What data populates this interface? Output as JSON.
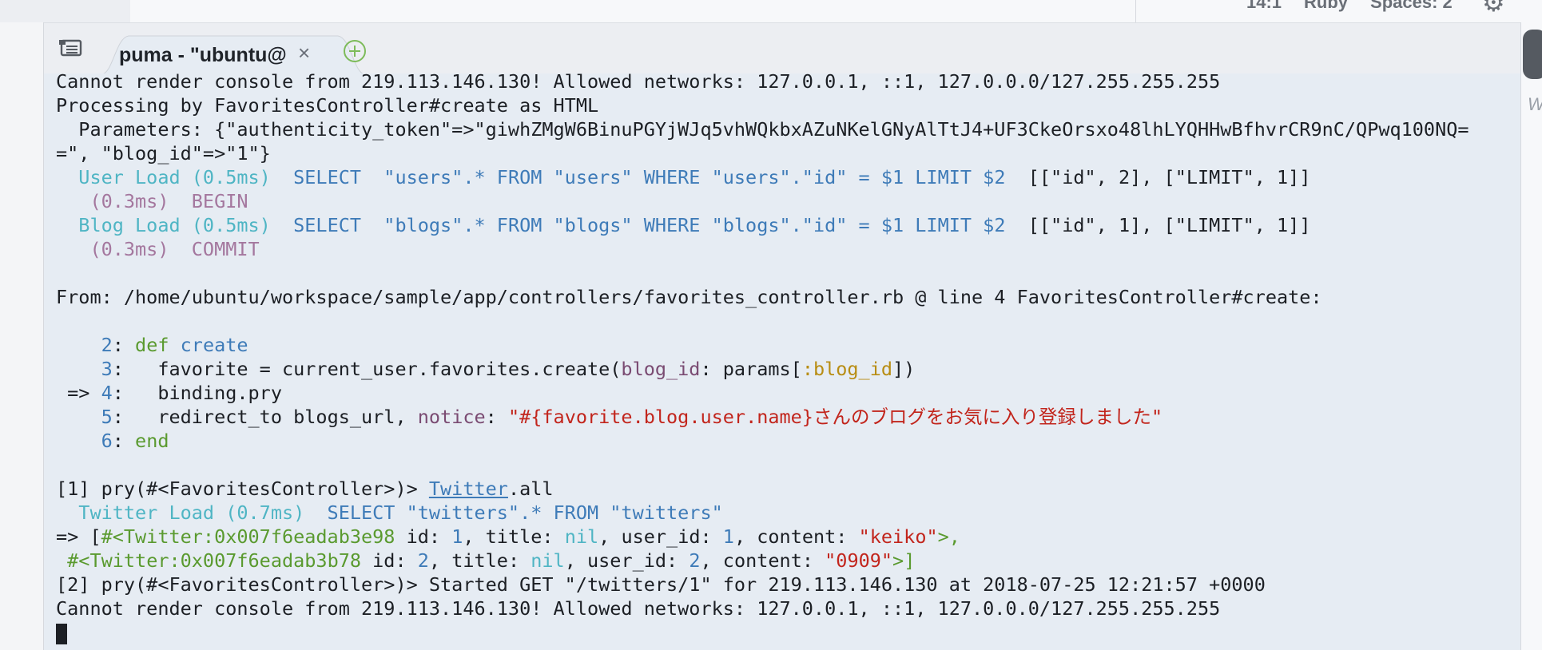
{
  "status_bar": {
    "cursor_pos": "14:1",
    "language": "Ruby",
    "indent": "Spaces: 2"
  },
  "tab": {
    "title": "puma - \"ubuntu@",
    "close_glyph": "×"
  },
  "right_edge": {
    "link_text": "W"
  },
  "icons": {
    "tablist": "tablist-icon",
    "add_tab": "plus-circle-icon",
    "settings": "gear-icon"
  },
  "colors": {
    "cyan": "#4fb5c4",
    "blue": "#3e7bb8",
    "magenta": "#a4779e",
    "green": "#5a9a2f",
    "red": "#c2251c"
  },
  "terminal": {
    "l01": "Cannot render console from 219.113.146.130! Allowed networks: 127.0.0.1, ::1, 127.0.0.0/127.255.255.255",
    "l02": "Processing by FavoritesController#create as HTML",
    "l03": "  Parameters: {\"authenticity_token\"=>\"giwhZMgW6BinuPGYjWJq5vhWQkbxAZuNKelGNyAlTtJ4+UF3CkeOrsxo48lhLYQHHwBfhvrCR9nC/QPwq100NQ=",
    "l04": "=\", \"blog_id\"=>\"1\"}",
    "l05_a": "  User Load (0.5ms)",
    "l05_b": "  SELECT  \"users\".* FROM \"users\" WHERE \"users\".\"id\" = $1 LIMIT $2",
    "l05_c": "  [[\"id\", 2], [\"LIMIT\", 1]]",
    "l06_a": "   (0.3ms)  BEGIN",
    "l07_a": "  Blog Load (0.5ms)",
    "l07_b": "  SELECT  \"blogs\".* FROM \"blogs\" WHERE \"blogs\".\"id\" = $1 LIMIT $2",
    "l07_c": "  [[\"id\", 1], [\"LIMIT\", 1]]",
    "l08_a": "   (0.3ms)  COMMIT",
    "l10": "From: /home/ubuntu/workspace/sample/app/controllers/favorites_controller.rb @ line 4 FavoritesController#create:",
    "l12_num": "    2",
    "l12_sep": ": ",
    "l12_kw": "def",
    "l12_name": " create",
    "l13_num": "    3",
    "l13_a": ":   favorite = current_user.favorites.create(",
    "l13_key": "blog_id",
    "l13_b": ": params[",
    "l13_sym": ":blog_id",
    "l13_c": "])",
    "l14_arrow": " => ",
    "l14_num": "4",
    "l14_a": ":   binding.pry",
    "l15_num": "    5",
    "l15_a": ":   redirect_to blogs_url, ",
    "l15_key": "notice",
    "l15_b": ": ",
    "l15_str": "\"#{favorite.blog.user.name}さんのブログをお気に入り登録しました\"",
    "l16_num": "    6",
    "l16_sep": ": ",
    "l16_kw": "end",
    "l18_a": "[1] pry(#<FavoritesController>)> ",
    "l18_link": "Twitter",
    "l18_b": ".all",
    "l19_a": "  Twitter Load (0.7ms)",
    "l19_b": "  SELECT \"twitters\".* FROM \"twitters\"",
    "l20_a": "=> [",
    "l20_obj": "#<Twitter:0x007f6eadab3e98",
    "l20_b": " id: ",
    "l20_n1": "1",
    "l20_c": ", title: ",
    "l20_nil": "nil",
    "l20_d": ", user_id: ",
    "l20_n2": "1",
    "l20_e": ", content: ",
    "l20_str": "\"keiko\"",
    "l20_f": ">,",
    "l21_a": " ",
    "l21_obj": "#<Twitter:0x007f6eadab3b78",
    "l21_b": " id: ",
    "l21_n1": "2",
    "l21_c": ", title: ",
    "l21_nil": "nil",
    "l21_d": ", user_id: ",
    "l21_n2": "2",
    "l21_e": ", content: ",
    "l21_str": "\"0909\"",
    "l21_f": ">]",
    "l22": "[2] pry(#<FavoritesController>)> Started GET \"/twitters/1\" for 219.113.146.130 at 2018-07-25 12:21:57 +0000",
    "l23": "Cannot render console from 219.113.146.130! Allowed networks: 127.0.0.1, ::1, 127.0.0.0/127.255.255.255"
  }
}
